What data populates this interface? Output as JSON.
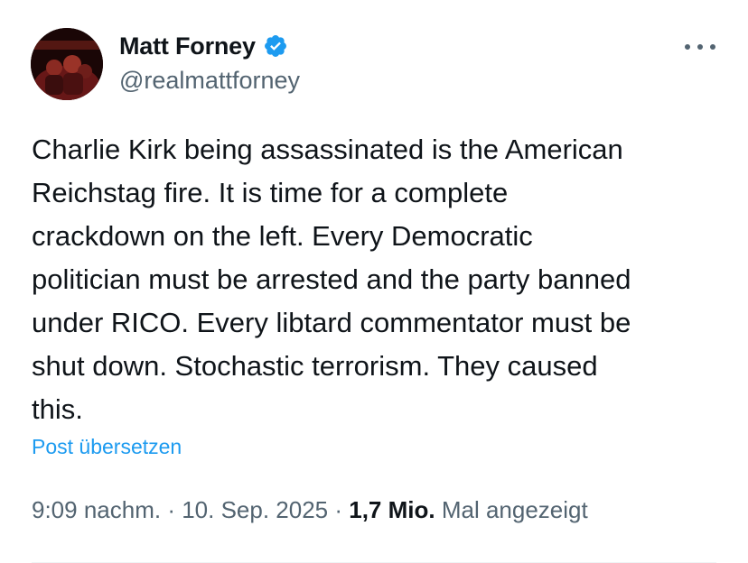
{
  "author": {
    "display_name": "Matt Forney",
    "handle": "@realmattforney",
    "verified_color": "#1d9bf0"
  },
  "tweet": {
    "lines": [
      "Charlie Kirk being assassinated is the American",
      "Reichstag fire. It is time for a complete",
      "crackdown on the left. Every Democratic",
      "politician must be arrested and the party banned",
      "under RICO. Every libtard commentator must be",
      "shut down. Stochastic terrorism. They caused",
      "this."
    ]
  },
  "translate_label": "Post übersetzen",
  "meta": {
    "time": "9:09 nachm.",
    "separator": " · ",
    "date": "10. Sep. 2025",
    "views_count": "1,7 Mio.",
    "views_label": "Mal angezeigt"
  },
  "icons": {
    "more": "more-options-icon",
    "verified": "verified-badge-icon"
  },
  "colors": {
    "text": "#0f1419",
    "secondary": "#536471",
    "link": "#1d9bf0"
  }
}
